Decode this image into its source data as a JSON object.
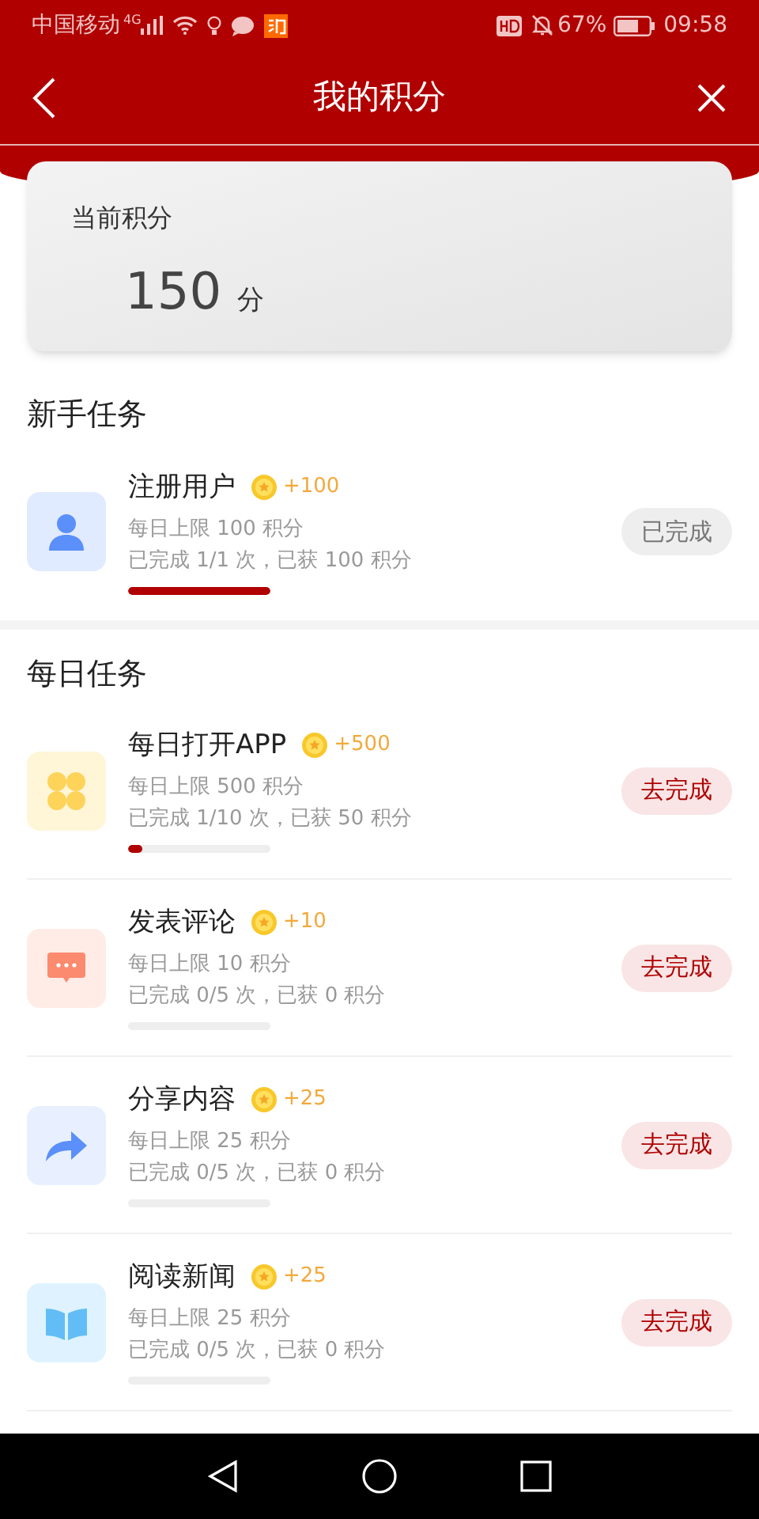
{
  "status_bar": {
    "carrier": "中国移动",
    "network": "4G",
    "battery": "67%",
    "time": "09:58"
  },
  "header": {
    "title": "我的积分"
  },
  "points": {
    "label": "当前积分",
    "value": "150",
    "unit": "分"
  },
  "sections": [
    {
      "title": "新手任务",
      "tasks": [
        {
          "kind": "person",
          "name": "注册用户",
          "reward": "+100",
          "limit": "每日上限 100 积分",
          "progress": "已完成 1/1 次，已获 100 积分",
          "level": 1,
          "completed": true,
          "button": "已完成"
        }
      ]
    },
    {
      "title": "每日任务",
      "tasks": [
        {
          "kind": "grid",
          "name": "每日打开APP",
          "reward": "+500",
          "limit": "每日上限 500 积分",
          "progress": "已完成 1/10 次，已获 50 积分",
          "level": 0.1,
          "completed": false,
          "button": "去完成"
        },
        {
          "kind": "chat",
          "name": "发表评论",
          "reward": "+10",
          "limit": "每日上限 10 积分",
          "progress": "已完成 0/5 次，已获 0 积分",
          "level": 0,
          "completed": false,
          "button": "去完成"
        },
        {
          "kind": "share",
          "name": "分享内容",
          "reward": "+25",
          "limit": "每日上限 25 积分",
          "progress": "已完成 0/5 次，已获 0 积分",
          "level": 0,
          "completed": false,
          "button": "去完成"
        },
        {
          "kind": "book",
          "name": "阅读新闻",
          "reward": "+25",
          "limit": "每日上限 25 积分",
          "progress": "已完成 0/5 次，已获 0 积分",
          "level": 0,
          "completed": false,
          "button": "去完成"
        }
      ]
    }
  ]
}
